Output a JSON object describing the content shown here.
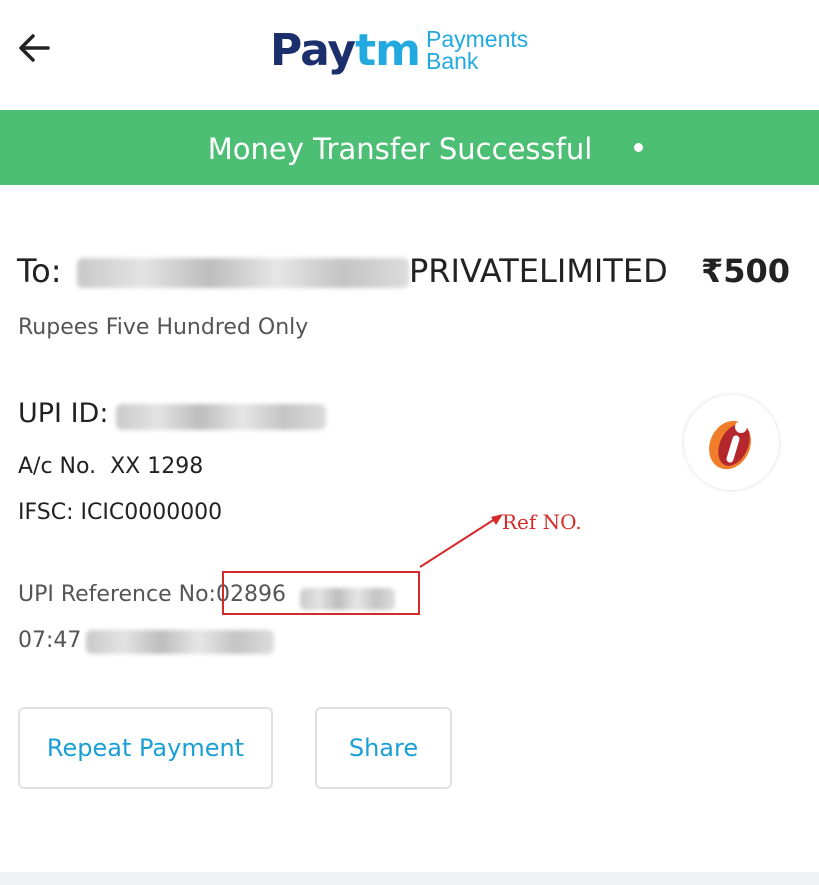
{
  "header": {
    "back_icon": "arrow-left-icon",
    "logo_pay_part1": "Pay",
    "logo_pay_part2": "tm",
    "logo_line1": "Payments",
    "logo_line2": "Bank"
  },
  "banner": {
    "status_text": "Money Transfer Successful",
    "color": "#4cbf74"
  },
  "transfer": {
    "to_label": "To:",
    "recipient_visible": "PRIVATELIMITED",
    "amount": "₹500",
    "amount_words": "Rupees Five Hundred Only"
  },
  "details": {
    "upi_label": "UPI ID:",
    "account_label": "A/c No.",
    "account_value": "XX 1298",
    "ifsc_label": "IFSC:",
    "ifsc_value": "ICIC0000000",
    "upi_ref_label": "UPI Reference No:",
    "upi_ref_visible": "02896",
    "time_visible": "07:47"
  },
  "annotation": {
    "label": "Ref NO.",
    "color": "#d42a2a"
  },
  "actions": {
    "repeat_label": "Repeat Payment",
    "share_label": "Share"
  }
}
